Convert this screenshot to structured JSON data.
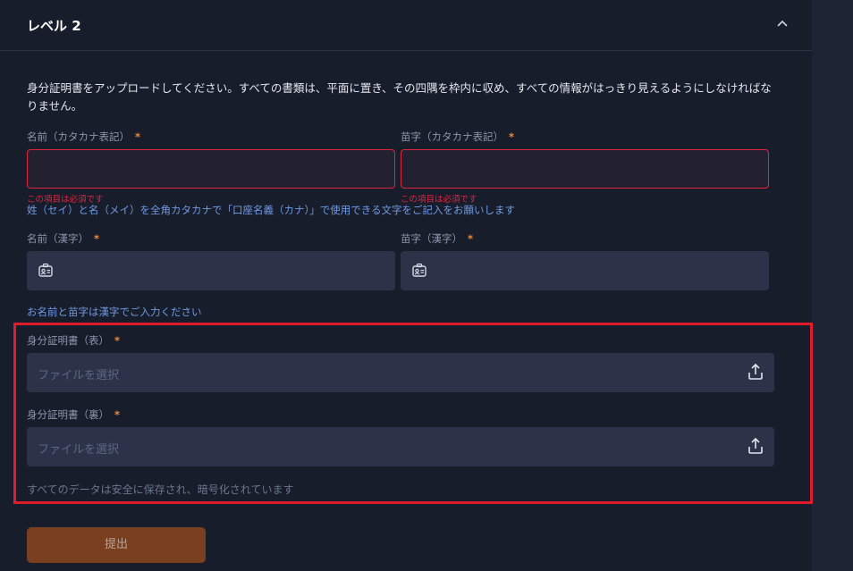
{
  "header": {
    "title": "レベル 2",
    "collapse_icon": "chevron-up-icon"
  },
  "description": "身分証明書をアップロードしてください。すべての書類は、平面に置き、その四隅を枠内に収め、すべての情報がはっきり見えるようにしなければなりません。",
  "required_mark": "*",
  "fields": {
    "first_name_kana": {
      "label": "名前（カタカナ表記）",
      "value": "",
      "error": "この項目は必須です"
    },
    "last_name_kana": {
      "label": "苗字（カタカナ表記）",
      "value": "",
      "error": "この項目は必須です"
    },
    "kana_hint": "姓（セイ）と名（メイ）を全角カタカナで「口座名義（カナ）」で使用できる文字をご記入をお願いします",
    "first_name_kanji": {
      "label": "名前（漢字）",
      "value": "",
      "icon": "id-card-icon"
    },
    "last_name_kanji": {
      "label": "苗字（漢字）",
      "value": "",
      "icon": "id-card-icon"
    },
    "kanji_hint": "お名前と苗字は漢字でご入力ください",
    "id_front": {
      "label": "身分証明書（表）",
      "placeholder": "ファイルを選択",
      "icon": "upload-icon"
    },
    "id_back": {
      "label": "身分証明書（裏）",
      "placeholder": "ファイルを選択",
      "icon": "upload-icon"
    }
  },
  "secure_note": "すべてのデータは安全に保存され、暗号化されています",
  "submit_label": "提出",
  "colors": {
    "background": "#181d2b",
    "input": "#2c3349",
    "error": "#e0243f",
    "accent": "#f08a3c",
    "hint": "#6f9ae6",
    "submit": "#7a3f1f",
    "highlight": "#e01b2a"
  }
}
